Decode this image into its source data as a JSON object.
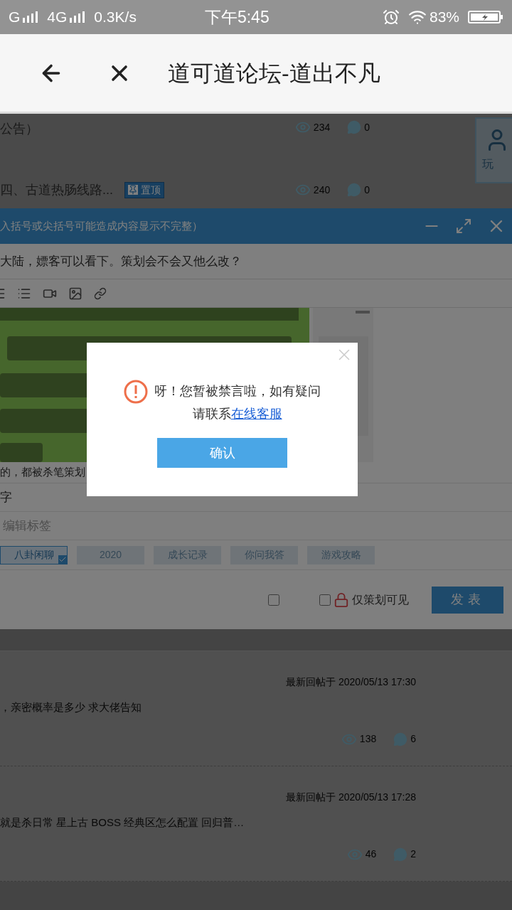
{
  "status_bar": {
    "network_1": "G",
    "network_2": "4G",
    "speed": "0.3K/s",
    "time": "下午5:45",
    "battery": "83%"
  },
  "header": {
    "title": "道可道论坛-道出不凡"
  },
  "threads_above": [
    {
      "title": "公告）",
      "views": "234",
      "comments": "0"
    },
    {
      "title": "四、古道热肠线路...",
      "badge": "置顶",
      "views": "240",
      "comments": "0"
    }
  ],
  "side_card": {
    "label": "玩"
  },
  "editor": {
    "notice": "入括号或尖括号可能造成内容显示不完整）",
    "subject": "大陆，嫖客可以看下。策划会不会又他么改？",
    "body_text": "的，都被杀笔策划",
    "line_2": "字",
    "tags_placeholder": "编辑标签",
    "tags": [
      {
        "label": "八卦闲聊",
        "selected": true
      },
      {
        "label": "2020",
        "selected": false
      },
      {
        "label": "成长记录",
        "selected": false
      },
      {
        "label": "你问我答",
        "selected": false
      },
      {
        "label": "游戏攻略",
        "selected": false
      }
    ],
    "options": [
      {
        "checked": false
      },
      {
        "checked": false,
        "label": "仅策划可见",
        "locked": true
      }
    ],
    "submit": "发表"
  },
  "threads_below": [
    {
      "last_reply": "最新回帖于 2020/05/13 17:30",
      "title": "，亲密概率是多少 求大佬告知",
      "views": "138",
      "comments": "6"
    },
    {
      "last_reply": "最新回帖于 2020/05/13 17:28",
      "title": "就是杀日常 星上古 BOSS 经典区怎么配置 回归普…",
      "views": "46",
      "comments": "2"
    }
  ],
  "dialog": {
    "message": "呀！您暂被禁言啦，如有疑问请联系",
    "link": "在线客服",
    "button": "确认"
  }
}
